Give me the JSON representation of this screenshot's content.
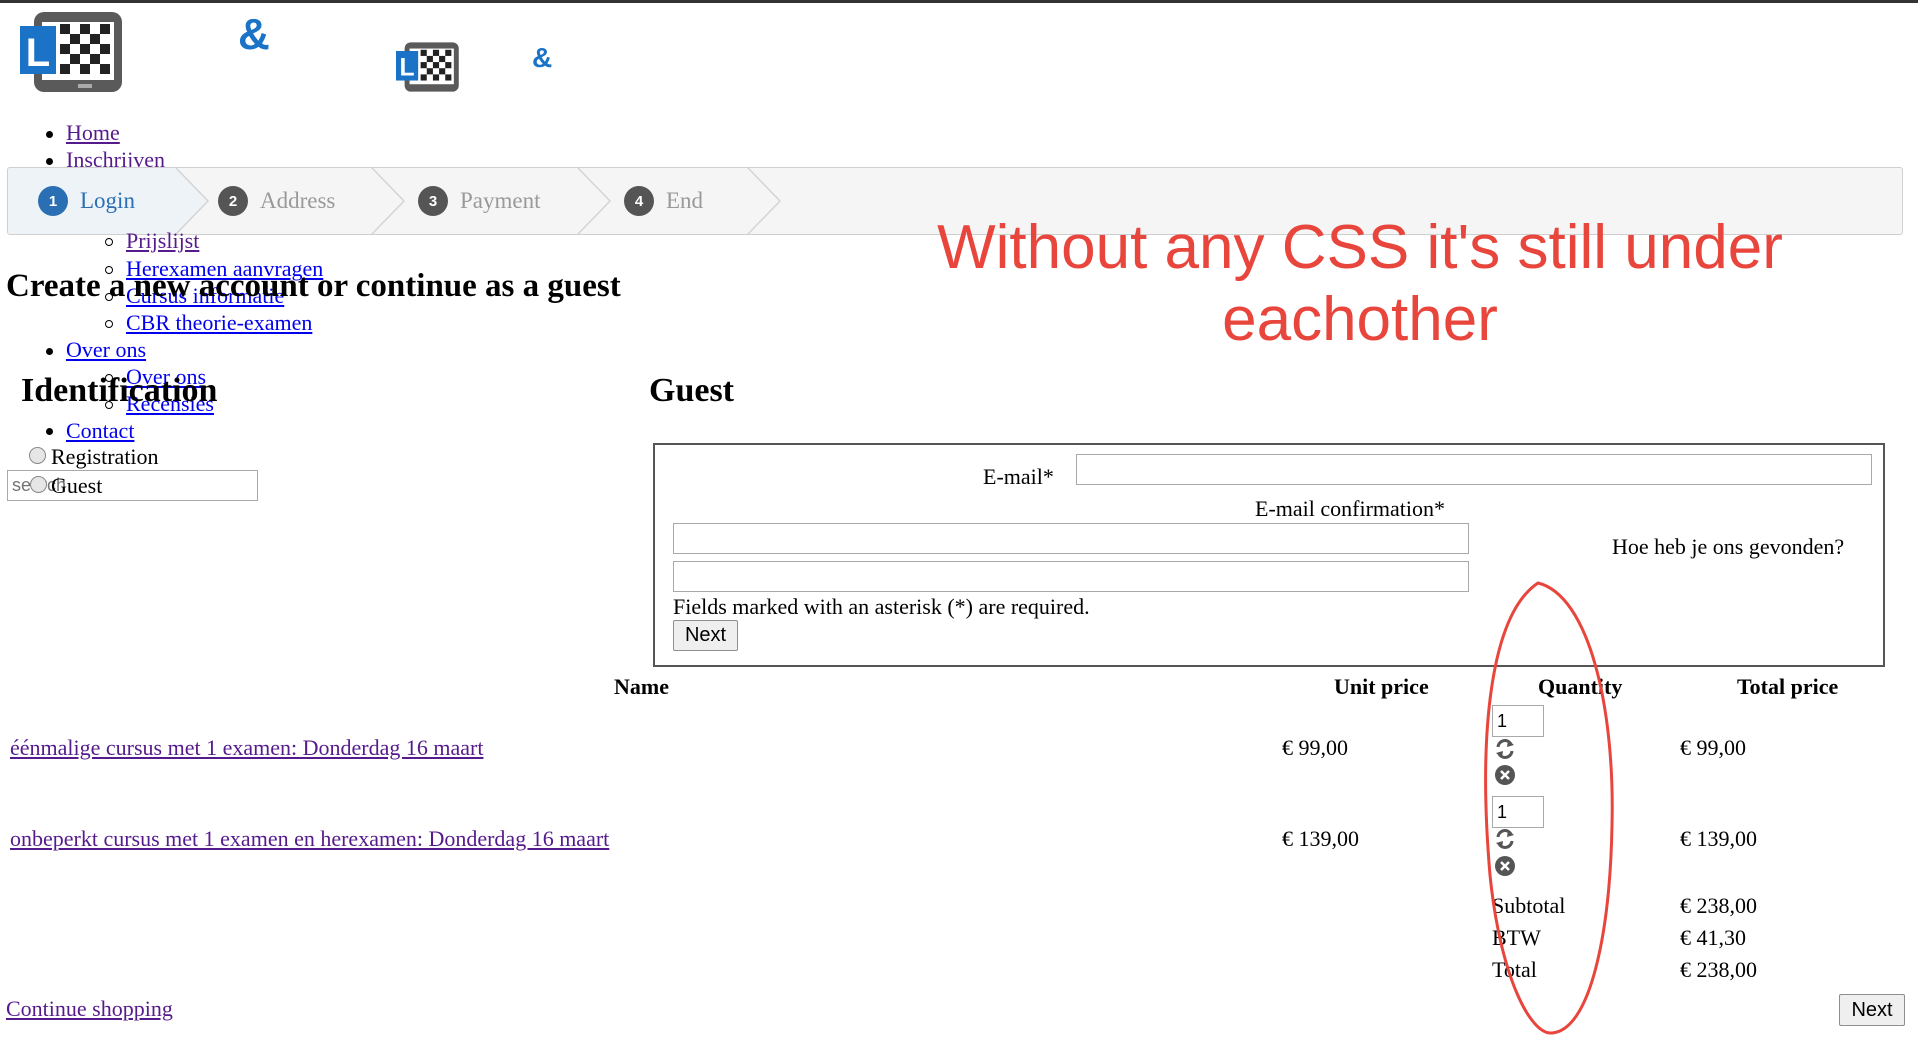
{
  "header": {
    "logo_letter": "L",
    "amp": "&"
  },
  "nav": {
    "items": [
      {
        "label": "Home"
      },
      {
        "label": "Inschrijven"
      },
      {
        "label": "Prijslijst"
      },
      {
        "label": "Herexamen aanvragen"
      },
      {
        "label": "Cursus informatie"
      },
      {
        "label": "CBR theorie-examen"
      },
      {
        "label": "Over ons"
      },
      {
        "label": "Over ons"
      },
      {
        "label": "Recensies"
      },
      {
        "label": "Contact"
      }
    ],
    "search_placeholder": "search"
  },
  "steps": [
    {
      "num": "1",
      "label": "Login",
      "active": true
    },
    {
      "num": "2",
      "label": "Address"
    },
    {
      "num": "3",
      "label": "Payment"
    },
    {
      "num": "4",
      "label": "End"
    }
  ],
  "page": {
    "title": "Create a new account or continue as a guest",
    "identification_heading": "Identification",
    "options": [
      "Registration",
      "Guest"
    ],
    "guest_heading": "Guest"
  },
  "guest_form": {
    "email_label": "E-mail*",
    "email_value": "",
    "email_confirm_label": "E-mail confirmation*",
    "email_confirm_value": "",
    "found_label": "Hoe heb je ons gevonden?",
    "found_value": "",
    "required_note": "Fields marked with an asterisk (*) are required.",
    "next_label": "Next"
  },
  "cart": {
    "headers": [
      "Name",
      "Unit price",
      "Quantity",
      "Total price"
    ],
    "rows": [
      {
        "name": "éénmalige cursus met 1 examen: Donderdag 16 maart",
        "unit": "€ 99,00",
        "qty": "1",
        "total": "€ 99,00"
      },
      {
        "name": "onbeperkt cursus met 1 examen en herexamen: Donderdag 16 maart",
        "unit": "€ 139,00",
        "qty": "1",
        "total": "€ 139,00"
      }
    ],
    "summary": [
      {
        "label": "Subtotal",
        "value": "€ 238,00"
      },
      {
        "label": "BTW",
        "value": "€ 41,30"
      },
      {
        "label": "Total",
        "value": "€ 238,00"
      }
    ],
    "continue_label": "Continue shopping",
    "next_label": "Next"
  },
  "annotation": {
    "line1": "Without any CSS it's still under",
    "line2": "eachother",
    "color": "#e8453c"
  }
}
